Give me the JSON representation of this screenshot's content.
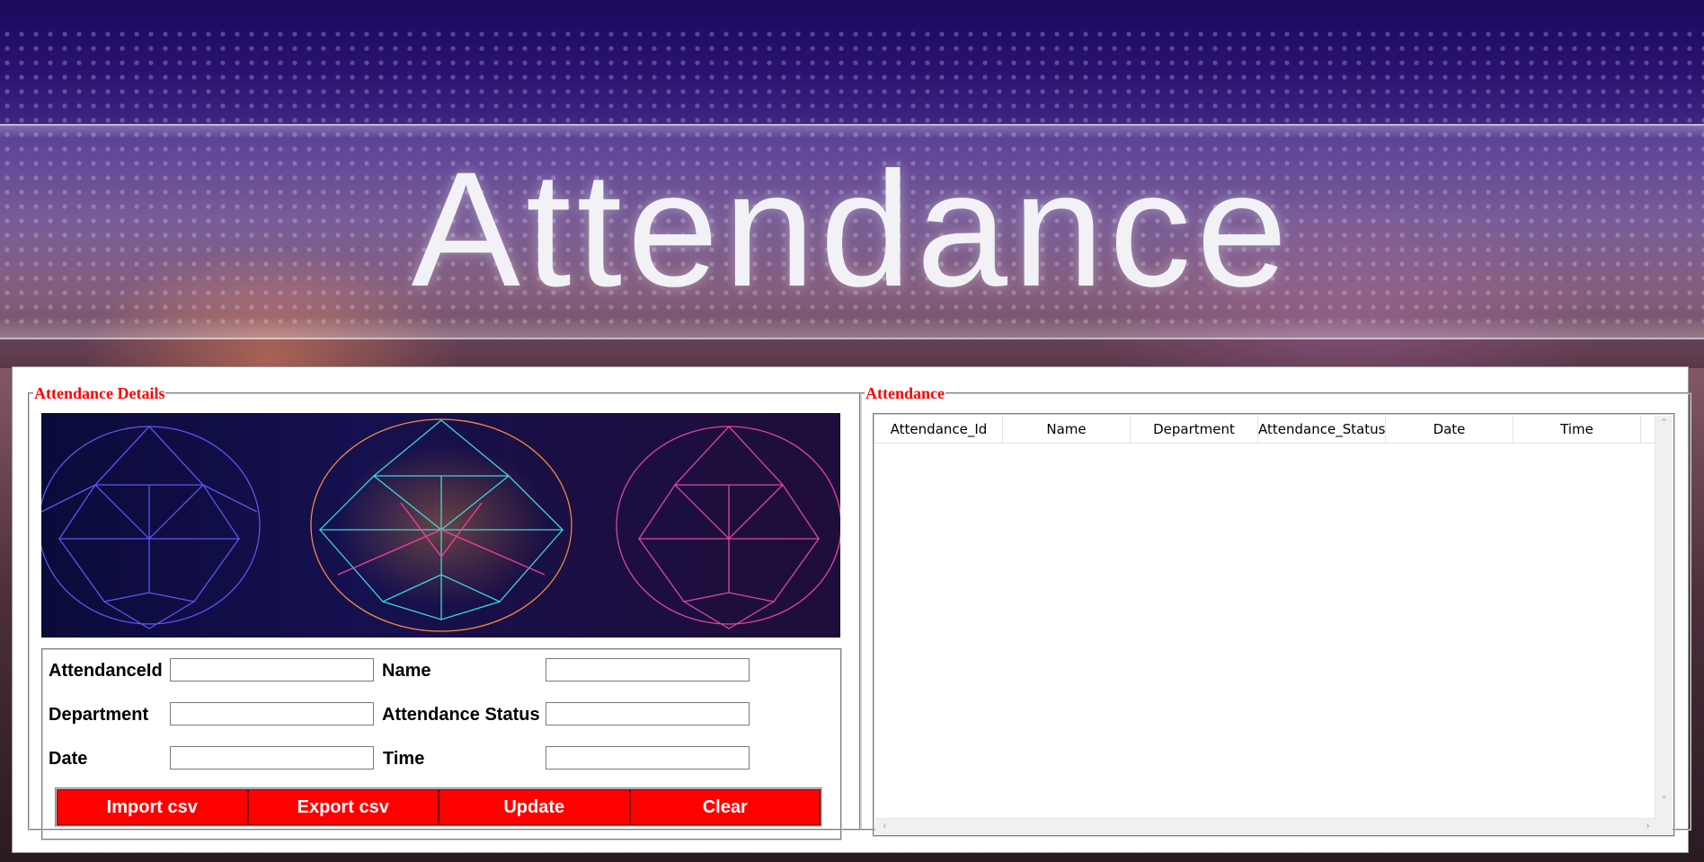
{
  "banner": {
    "title": "Attendance"
  },
  "left_panel": {
    "legend": "Attendance Details",
    "form": {
      "attendance_id": {
        "label": "AttendanceId",
        "value": ""
      },
      "name": {
        "label": "Name",
        "value": ""
      },
      "department": {
        "label": "Department",
        "value": ""
      },
      "attendance_status": {
        "label": "Attendance Status",
        "value": ""
      },
      "date": {
        "label": "Date",
        "value": ""
      },
      "time": {
        "label": "Time",
        "value": ""
      }
    },
    "buttons": {
      "import_csv": "Import csv",
      "export_csv": "Export csv",
      "update": "Update",
      "clear": "Clear"
    },
    "colors": {
      "legend": "#ff0000",
      "button_bg": "#ff0000",
      "button_text": "#ffffff"
    }
  },
  "right_panel": {
    "legend": "Attendance",
    "table": {
      "columns": [
        "Attendance_Id",
        "Name",
        "Department",
        "Attendance_Status",
        "Date",
        "Time"
      ],
      "rows": []
    }
  },
  "icons": {
    "scroll_up": "scroll-up-arrow-icon",
    "scroll_down": "scroll-down-arrow-icon",
    "scroll_left": "scroll-left-arrow-icon",
    "scroll_right": "scroll-right-arrow-icon"
  }
}
